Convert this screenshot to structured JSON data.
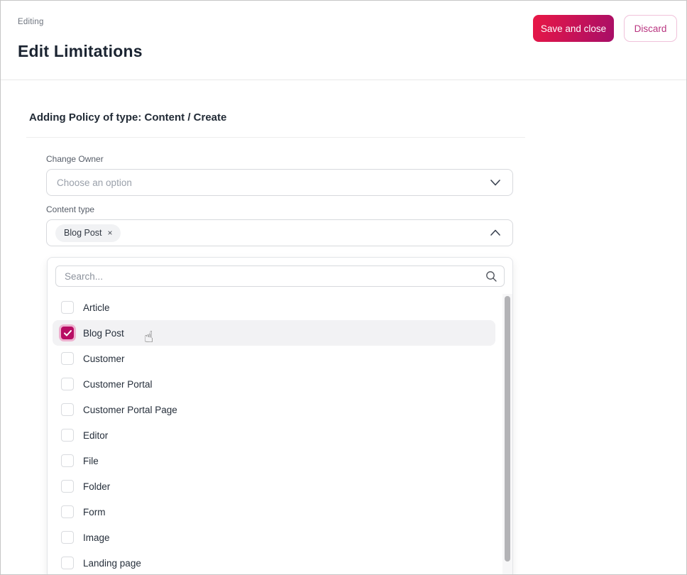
{
  "header": {
    "eyebrow": "Editing",
    "title": "Edit Limitations",
    "save_label": "Save and close",
    "discard_label": "Discard"
  },
  "colors": {
    "accent": "#b80d64",
    "save_gradient_start": "#e91745",
    "save_gradient_end": "#a70e68",
    "discard_text": "#b93580",
    "row_highlight": "#f2f2f4"
  },
  "form": {
    "section_title": "Adding Policy of type: Content / Create",
    "owner_field": {
      "label": "Change Owner",
      "placeholder": "Choose an option"
    },
    "content_type_field": {
      "label": "Content type",
      "selected_tag": "Blog Post",
      "tag_remove": "×"
    }
  },
  "dropdown": {
    "search_placeholder": "Search...",
    "options": [
      {
        "label": "Article",
        "checked": false,
        "highlighted": false
      },
      {
        "label": "Blog Post",
        "checked": true,
        "highlighted": true
      },
      {
        "label": "Customer",
        "checked": false,
        "highlighted": false
      },
      {
        "label": "Customer Portal",
        "checked": false,
        "highlighted": false
      },
      {
        "label": "Customer Portal Page",
        "checked": false,
        "highlighted": false
      },
      {
        "label": "Editor",
        "checked": false,
        "highlighted": false
      },
      {
        "label": "File",
        "checked": false,
        "highlighted": false
      },
      {
        "label": "Folder",
        "checked": false,
        "highlighted": false
      },
      {
        "label": "Form",
        "checked": false,
        "highlighted": false
      },
      {
        "label": "Image",
        "checked": false,
        "highlighted": false
      },
      {
        "label": "Landing page",
        "checked": false,
        "highlighted": false
      }
    ]
  },
  "cursor": {
    "glyph": "☝"
  }
}
